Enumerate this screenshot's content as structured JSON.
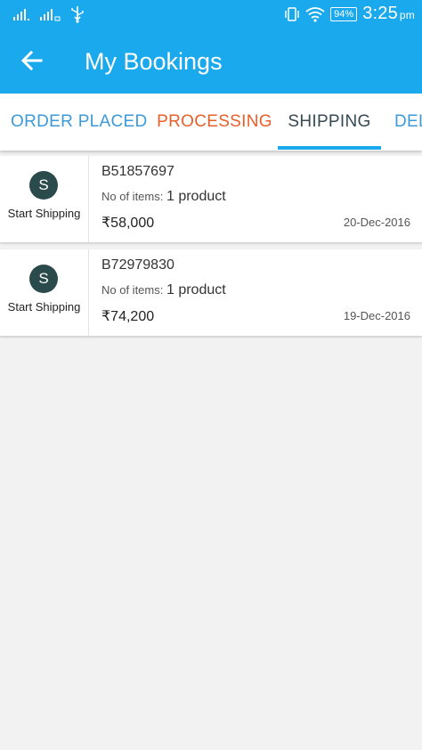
{
  "statusbar": {
    "battery": "94%",
    "time": "3:25",
    "ampm": "pm"
  },
  "appbar": {
    "title": "My Bookings"
  },
  "tabs": [
    {
      "label": "ORDER PLACED"
    },
    {
      "label": "PROCESSING"
    },
    {
      "label": "SHIPPING"
    },
    {
      "label": "DEL"
    }
  ],
  "selected_tab": "SHIPPING",
  "colors": {
    "primary": "#1aa9ec",
    "tab_blue": "#3d9ad8",
    "tab_orange": "#e6602a",
    "tab_active": "#354a55",
    "avatar": "#2b4a4b"
  },
  "bookings": [
    {
      "avatar_letter": "S",
      "status": "Start Shipping",
      "id": "B51857697",
      "items_label": "No of items:",
      "items_value": "1 product",
      "amount": "₹58,000",
      "date": "20-Dec-2016"
    },
    {
      "avatar_letter": "S",
      "status": "Start Shipping",
      "id": "B72979830",
      "items_label": "No of items:",
      "items_value": "1 product",
      "amount": "₹74,200",
      "date": "19-Dec-2016"
    }
  ]
}
